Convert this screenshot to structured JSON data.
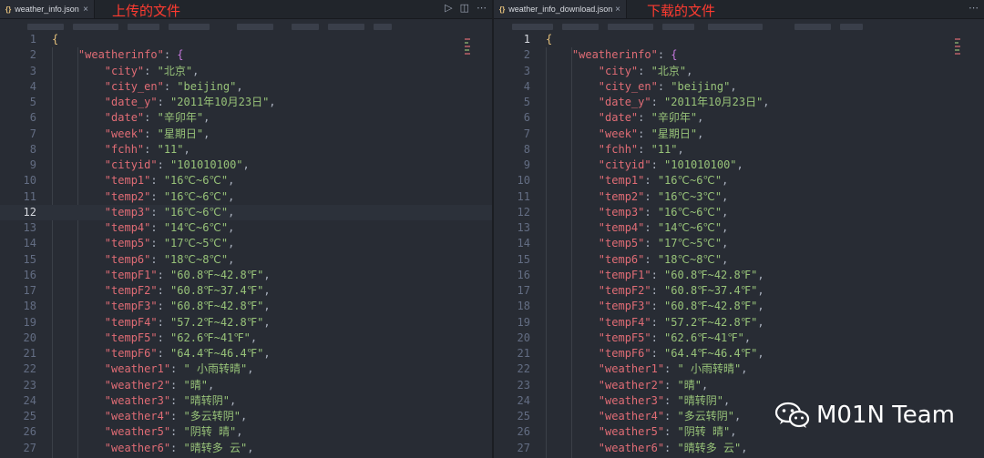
{
  "left": {
    "tab_label": "weather_info.json",
    "caption": "上传的文件"
  },
  "right": {
    "tab_label": "weather_info_download.json",
    "caption": "下载的文件"
  },
  "watermark": "M01N Team",
  "colors": {
    "caption": "#ff3b30",
    "key": "#e06c75",
    "string": "#98c379",
    "bracket": "#c678dd"
  },
  "left_active_line": 12,
  "right_active_line": 1,
  "left_lines": [
    {
      "n": "1",
      "c": "{"
    },
    {
      "n": "2",
      "k": "\"weatherinfo\"",
      "c": "{"
    },
    {
      "n": "3",
      "k": "\"city\"",
      "v": "\"北京\""
    },
    {
      "n": "4",
      "k": "\"city_en\"",
      "v": "\"beijing\""
    },
    {
      "n": "5",
      "k": "\"date_y\"",
      "v": "\"2011年10月23日\""
    },
    {
      "n": "6",
      "k": "\"date\"",
      "v": "\"辛卯年\""
    },
    {
      "n": "7",
      "k": "\"week\"",
      "v": "\"星期日\""
    },
    {
      "n": "8",
      "k": "\"fchh\"",
      "v": "\"11\""
    },
    {
      "n": "9",
      "k": "\"cityid\"",
      "v": "\"101010100\""
    },
    {
      "n": "10",
      "k": "\"temp1\"",
      "v": "\"16℃~6℃\""
    },
    {
      "n": "11",
      "k": "\"temp2\"",
      "v": "\"16℃~6℃\""
    },
    {
      "n": "12",
      "k": "\"temp3\"",
      "v": "\"16℃~6℃\""
    },
    {
      "n": "13",
      "k": "\"temp4\"",
      "v": "\"14℃~6℃\""
    },
    {
      "n": "14",
      "k": "\"temp5\"",
      "v": "\"17℃~5℃\""
    },
    {
      "n": "15",
      "k": "\"temp6\"",
      "v": "\"18℃~8℃\""
    },
    {
      "n": "16",
      "k": "\"tempF1\"",
      "v": "\"60.8℉~42.8℉\""
    },
    {
      "n": "17",
      "k": "\"tempF2\"",
      "v": "\"60.8℉~37.4℉\""
    },
    {
      "n": "18",
      "k": "\"tempF3\"",
      "v": "\"60.8℉~42.8℉\""
    },
    {
      "n": "19",
      "k": "\"tempF4\"",
      "v": "\"57.2℉~42.8℉\""
    },
    {
      "n": "20",
      "k": "\"tempF5\"",
      "v": "\"62.6℉~41℉\""
    },
    {
      "n": "21",
      "k": "\"tempF6\"",
      "v": "\"64.4℉~46.4℉\""
    },
    {
      "n": "22",
      "k": "\"weather1\"",
      "v": "\" 小雨转晴\""
    },
    {
      "n": "23",
      "k": "\"weather2\"",
      "v": "\"晴\""
    },
    {
      "n": "24",
      "k": "\"weather3\"",
      "v": "\"晴转阴\""
    },
    {
      "n": "25",
      "k": "\"weather4\"",
      "v": "\"多云转阴\""
    },
    {
      "n": "26",
      "k": "\"weather5\"",
      "v": "\"阴转 晴\""
    },
    {
      "n": "27",
      "k": "\"weather6\"",
      "v": "\"晴转多 云\""
    }
  ],
  "right_lines": [
    {
      "n": "1",
      "c": "{"
    },
    {
      "n": "2",
      "k": "\"weatherinfo\"",
      "c": "{"
    },
    {
      "n": "3",
      "k": "\"city\"",
      "v": "\"北京\""
    },
    {
      "n": "4",
      "k": "\"city_en\"",
      "v": "\"beijing\""
    },
    {
      "n": "5",
      "k": "\"date_y\"",
      "v": "\"2011年10月23日\""
    },
    {
      "n": "6",
      "k": "\"date\"",
      "v": "\"辛卯年\""
    },
    {
      "n": "7",
      "k": "\"week\"",
      "v": "\"星期日\""
    },
    {
      "n": "8",
      "k": "\"fchh\"",
      "v": "\"11\""
    },
    {
      "n": "9",
      "k": "\"cityid\"",
      "v": "\"101010100\""
    },
    {
      "n": "10",
      "k": "\"temp1\"",
      "v": "\"16℃~6℃\""
    },
    {
      "n": "11",
      "k": "\"temp2\"",
      "v": "\"16℃~3℃\""
    },
    {
      "n": "12",
      "k": "\"temp3\"",
      "v": "\"16℃~6℃\""
    },
    {
      "n": "13",
      "k": "\"temp4\"",
      "v": "\"14℃~6℃\""
    },
    {
      "n": "14",
      "k": "\"temp5\"",
      "v": "\"17℃~5℃\""
    },
    {
      "n": "15",
      "k": "\"temp6\"",
      "v": "\"18℃~8℃\""
    },
    {
      "n": "16",
      "k": "\"tempF1\"",
      "v": "\"60.8℉~42.8℉\""
    },
    {
      "n": "17",
      "k": "\"tempF2\"",
      "v": "\"60.8℉~37.4℉\""
    },
    {
      "n": "18",
      "k": "\"tempF3\"",
      "v": "\"60.8℉~42.8℉\""
    },
    {
      "n": "19",
      "k": "\"tempF4\"",
      "v": "\"57.2℉~42.8℉\""
    },
    {
      "n": "20",
      "k": "\"tempF5\"",
      "v": "\"62.6℉~41℉\""
    },
    {
      "n": "21",
      "k": "\"tempF6\"",
      "v": "\"64.4℉~46.4℉\""
    },
    {
      "n": "22",
      "k": "\"weather1\"",
      "v": "\" 小雨转晴\""
    },
    {
      "n": "23",
      "k": "\"weather2\"",
      "v": "\"晴\""
    },
    {
      "n": "24",
      "k": "\"weather3\"",
      "v": "\"晴转阴\""
    },
    {
      "n": "25",
      "k": "\"weather4\"",
      "v": "\"多云转阴\""
    },
    {
      "n": "26",
      "k": "\"weather5\"",
      "v": "\"阴转 晴\""
    },
    {
      "n": "27",
      "k": "\"weather6\"",
      "v": "\"晴转多 云\""
    }
  ]
}
